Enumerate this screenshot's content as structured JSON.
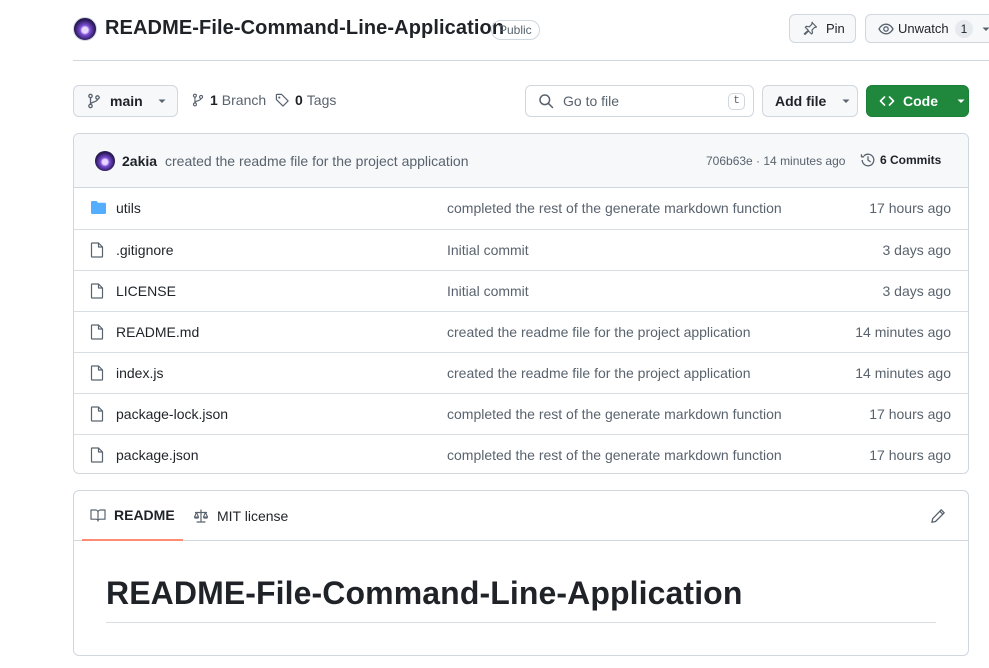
{
  "repo": {
    "name": "README-File-Command-Line-Application",
    "visibility": "Public"
  },
  "actions": {
    "pin_label": "Pin",
    "unwatch_label": "Unwatch",
    "watch_count": "1"
  },
  "toolbar": {
    "branch": "main",
    "branches_count": "1",
    "branches_label": "Branch",
    "tags_count": "0",
    "tags_label": "Tags",
    "search_placeholder": "Go to file",
    "search_shortcut": "t",
    "add_file_label": "Add file",
    "code_label": "Code"
  },
  "latest_commit": {
    "author": "2akia",
    "message": "created the readme file for the project application",
    "meta": "706b63e · 14 minutes ago",
    "commits_count_label": "6 Commits"
  },
  "files": [
    {
      "name": "utils",
      "type": "folder",
      "commit": "completed the rest of the generate markdown function",
      "time": "17 hours ago"
    },
    {
      "name": ".gitignore",
      "type": "file",
      "commit": "Initial commit",
      "time": "3 days ago"
    },
    {
      "name": "LICENSE",
      "type": "file",
      "commit": "Initial commit",
      "time": "3 days ago"
    },
    {
      "name": "README.md",
      "type": "file",
      "commit": "created the readme file for the project application",
      "time": "14 minutes ago"
    },
    {
      "name": "index.js",
      "type": "file",
      "commit": "created the readme file for the project application",
      "time": "14 minutes ago"
    },
    {
      "name": "package-lock.json",
      "type": "file",
      "commit": "completed the rest of the generate markdown function",
      "time": "17 hours ago"
    },
    {
      "name": "package.json",
      "type": "file",
      "commit": "completed the rest of the generate markdown function",
      "time": "17 hours ago"
    }
  ],
  "readme": {
    "tab_readme": "README",
    "tab_license": "MIT license",
    "heading": "README-File-Command-Line-Application"
  },
  "colors": {
    "primary_button": "#1f883d",
    "folder_icon": "#54aeff",
    "active_tab_underline": "#fd8c73",
    "border": "#d0d7de",
    "muted_text": "#59636e"
  }
}
